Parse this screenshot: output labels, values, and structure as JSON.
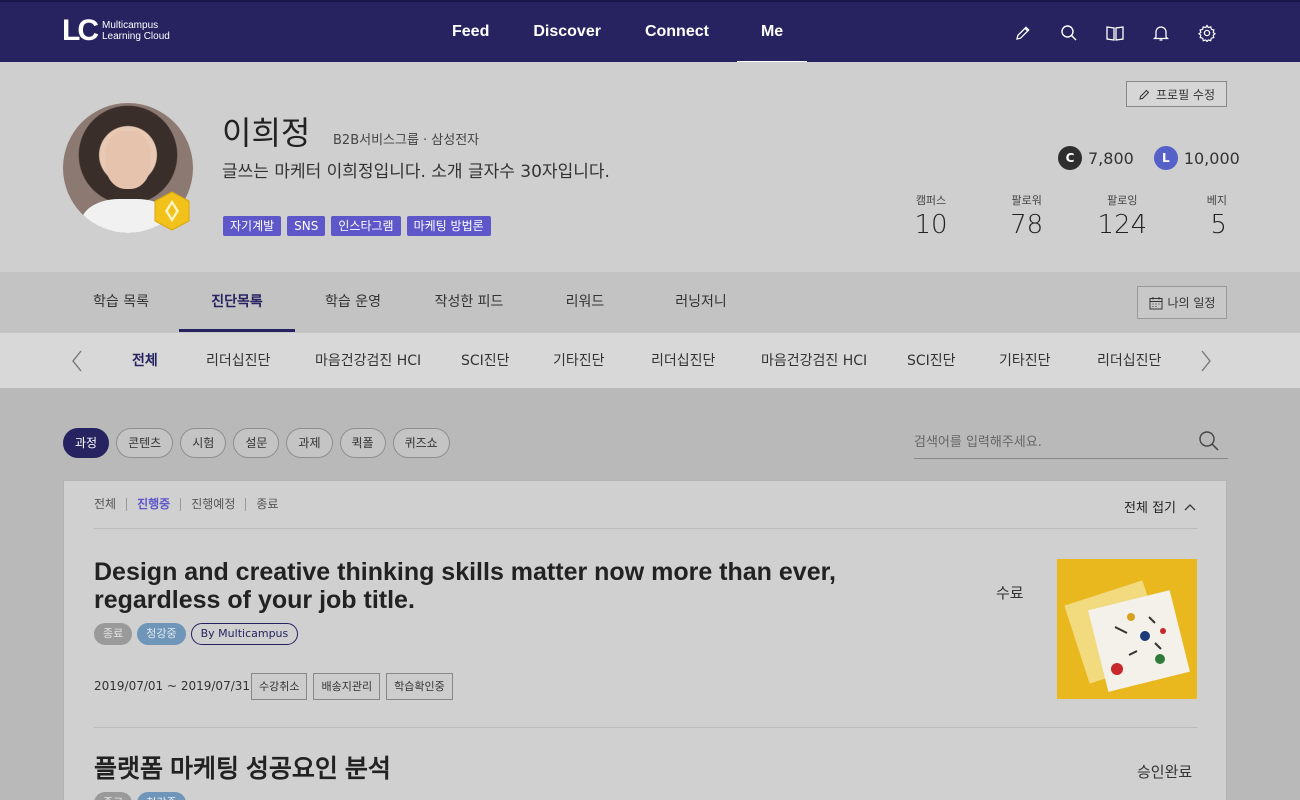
{
  "brand": {
    "mark": "LC",
    "line1": "Multicampus",
    "line2": "Learning Cloud"
  },
  "nav": {
    "items": [
      "Feed",
      "Discover",
      "Connect",
      "Me"
    ],
    "active": "Me"
  },
  "profile": {
    "name": "이희정",
    "org": "B2B서비스그룹 · 삼성전자",
    "intro": "글쓰는 마케터 이희정입니다. 소개 글자수 30자입니다.",
    "tags": [
      "자기계발",
      "SNS",
      "인스타그램",
      "마케팅 방법론"
    ],
    "edit_label": "프로필 수정",
    "points": {
      "c_letter": "C",
      "c_value": "7,800",
      "l_letter": "L",
      "l_value": "10,000"
    },
    "stats": [
      {
        "label": "캠퍼스",
        "value": "10"
      },
      {
        "label": "팔로워",
        "value": "78"
      },
      {
        "label": "팔로잉",
        "value": "124"
      },
      {
        "label": "베지",
        "value": "5"
      }
    ]
  },
  "tabs": {
    "items": [
      "학습 목록",
      "진단목록",
      "학습 운영",
      "작성한 피드",
      "리워드",
      "러닝저니"
    ],
    "active": "진단목록",
    "schedule_label": "나의 일정"
  },
  "subtabs": {
    "items": [
      "전체",
      "리더십진단",
      "마음건강검진 HCI",
      "SCI진단",
      "기타진단",
      "리더십진단",
      "마음건강검진 HCI",
      "SCI진단",
      "기타진단",
      "리더십진단"
    ],
    "active": "전체"
  },
  "filters": {
    "items": [
      "과정",
      "콘텐츠",
      "시험",
      "설문",
      "과제",
      "퀵폴",
      "퀴즈쇼"
    ],
    "active": "과정"
  },
  "search": {
    "placeholder": "검색어를 입력해주세요."
  },
  "panel": {
    "status_filters": [
      "전체",
      "진행중",
      "진행예정",
      "종료"
    ],
    "status_active": "진행중",
    "collapse_label": "전체 접기",
    "courses": [
      {
        "title": "Design and creative thinking skills matter now more than ever, regardless of your job title.",
        "badges": [
          "종료",
          "청강중",
          "By Multicampus"
        ],
        "date": "2019/07/01 ~ 2019/07/31",
        "actions": [
          "수강취소",
          "배송지관리",
          "학습확인중"
        ],
        "status": "수료"
      },
      {
        "title": "플랫폼 마케팅 성공요인 분석",
        "badges": [
          "종료",
          "청강중"
        ],
        "status": "승인완료"
      }
    ]
  },
  "colors": {
    "navy": "#262360",
    "accent": "#5e57c9",
    "medal": "#f2c21b"
  }
}
